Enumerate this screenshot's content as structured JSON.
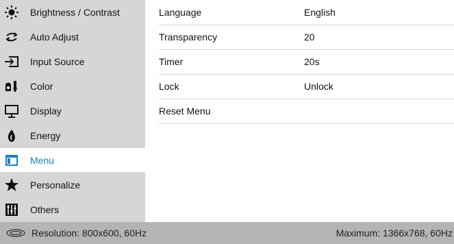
{
  "sidebar": {
    "items": [
      {
        "label": "Brightness / Contrast",
        "icon": "brightness-icon"
      },
      {
        "label": "Auto Adjust",
        "icon": "auto-adjust-icon"
      },
      {
        "label": "Input Source",
        "icon": "input-source-icon"
      },
      {
        "label": "Color",
        "icon": "color-icon"
      },
      {
        "label": "Display",
        "icon": "display-icon"
      },
      {
        "label": "Energy",
        "icon": "energy-icon"
      },
      {
        "label": "Menu",
        "icon": "menu-icon",
        "active": true
      },
      {
        "label": "Personalize",
        "icon": "star-icon"
      },
      {
        "label": "Others",
        "icon": "others-icon"
      }
    ]
  },
  "menu_settings": {
    "rows": [
      {
        "label": "Language",
        "value": "English"
      },
      {
        "label": "Transparency",
        "value": "20"
      },
      {
        "label": "Timer",
        "value": "20s"
      },
      {
        "label": "Lock",
        "value": "Unlock"
      },
      {
        "label": "Reset Menu",
        "value": ""
      }
    ]
  },
  "footer": {
    "resolution": "Resolution: 800x600, 60Hz",
    "maximum": "Maximum: 1366x768, 60Hz"
  },
  "colors": {
    "sidebar_bg": "#d6d6d6",
    "active_text": "#1a7fc0",
    "footer_bg": "#b4b4b4"
  }
}
